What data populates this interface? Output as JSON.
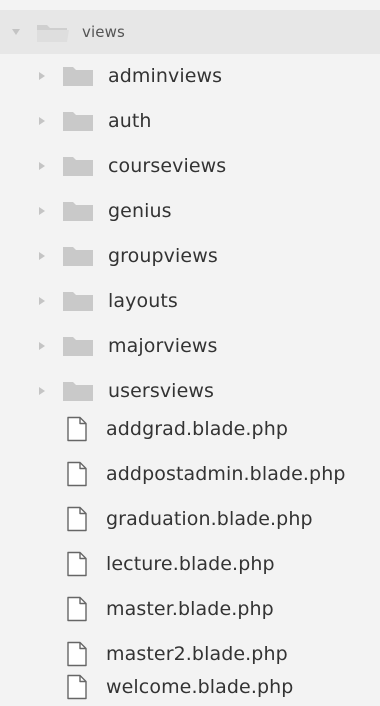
{
  "explorer": {
    "root": {
      "label": "views",
      "expanded": true
    },
    "folders": [
      {
        "label": "adminviews"
      },
      {
        "label": "auth"
      },
      {
        "label": "courseviews"
      },
      {
        "label": "genius"
      },
      {
        "label": "groupviews"
      },
      {
        "label": "layouts"
      },
      {
        "label": "majorviews"
      },
      {
        "label": "usersviews"
      }
    ],
    "files": [
      {
        "label": "addgrad.blade.php"
      },
      {
        "label": "addpostadmin.blade.php"
      },
      {
        "label": "graduation.blade.php"
      },
      {
        "label": "lecture.blade.php"
      },
      {
        "label": "master.blade.php"
      },
      {
        "label": "master2.blade.php"
      },
      {
        "label": "welcome.blade.php"
      }
    ]
  },
  "icons": {
    "collapsed": "chevron-right-icon",
    "expanded": "chevron-down-icon",
    "folder": "folder-icon",
    "file": "file-icon"
  },
  "colors": {
    "background": "#f3f3f3",
    "root_highlight": "#e7e7e7",
    "text": "#333333",
    "folder": "#c9c9c9",
    "chevron": "#c4c4c4"
  }
}
